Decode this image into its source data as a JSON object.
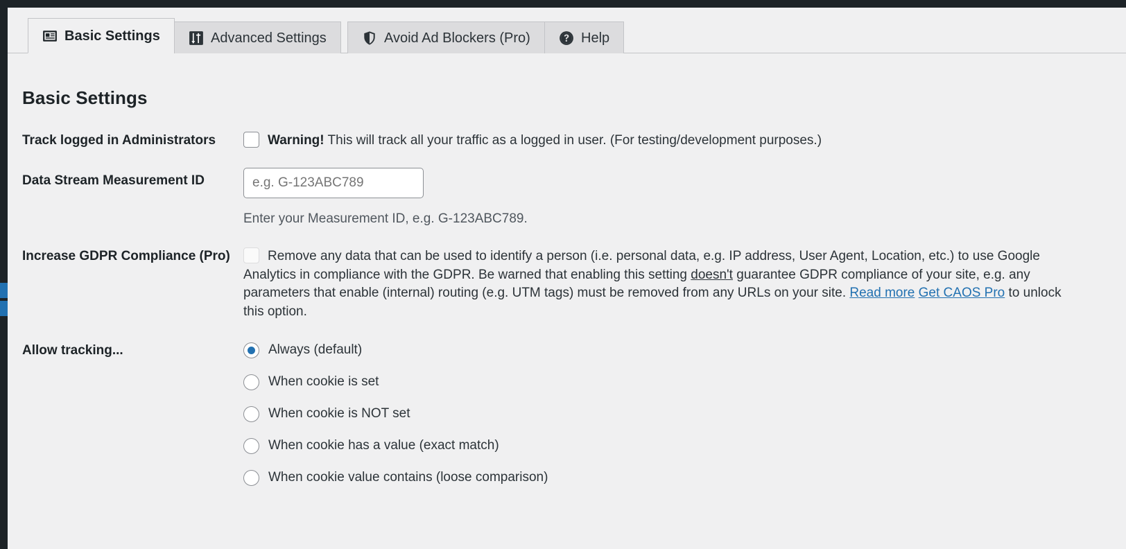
{
  "tabs": [
    {
      "label": "Basic Settings",
      "icon": "id-card-icon",
      "active": true
    },
    {
      "label": "Advanced Settings",
      "icon": "sliders-icon",
      "active": false
    },
    {
      "label": "Avoid Ad Blockers (Pro)",
      "icon": "shield-icon",
      "active": false
    },
    {
      "label": "Help",
      "icon": "question-circle-icon",
      "active": false
    }
  ],
  "page": {
    "title": "Basic Settings"
  },
  "rows": {
    "track_admins": {
      "label": "Track logged in Administrators",
      "checkbox_checked": false,
      "warn_prefix": "Warning!",
      "text": " This will track all your traffic as a logged in user. (For testing/development purposes.)"
    },
    "measurement_id": {
      "label": "Data Stream Measurement ID",
      "value": "",
      "placeholder": "e.g. G-123ABC789",
      "description": "Enter your Measurement ID, e.g. G-123ABC789."
    },
    "gdpr": {
      "label": "Increase GDPR Compliance (Pro)",
      "checkbox_checked": false,
      "checkbox_disabled": true,
      "text_1": "Remove any data that can be used to identify a person (i.e. personal data, e.g. IP address, User Agent, Location, etc.) to use Google Analytics in compliance with the GDPR. Be warned that enabling this setting ",
      "emphasis": "doesn't",
      "text_2": " guarantee GDPR compliance of your site, e.g. any parameters that enable (internal) routing (e.g. UTM tags) must be removed from any URLs on your site. ",
      "link_1": "Read more",
      "text_3": " ",
      "link_2": "Get CAOS Pro",
      "text_4": " to unlock this option."
    },
    "allow_tracking": {
      "label": "Allow tracking...",
      "options": [
        {
          "label": "Always (default)",
          "selected": true
        },
        {
          "label": "When cookie is set",
          "selected": false
        },
        {
          "label": "When cookie is NOT set",
          "selected": false
        },
        {
          "label": "When cookie has a value (exact match)",
          "selected": false
        },
        {
          "label": "When cookie value contains (loose comparison)",
          "selected": false
        }
      ]
    }
  },
  "colors": {
    "accent": "#2271b1",
    "admin_chrome": "#1d2327",
    "page_bg": "#f0f0f1",
    "tab_inactive_bg": "#dcdcde",
    "border": "#c3c4c7"
  }
}
